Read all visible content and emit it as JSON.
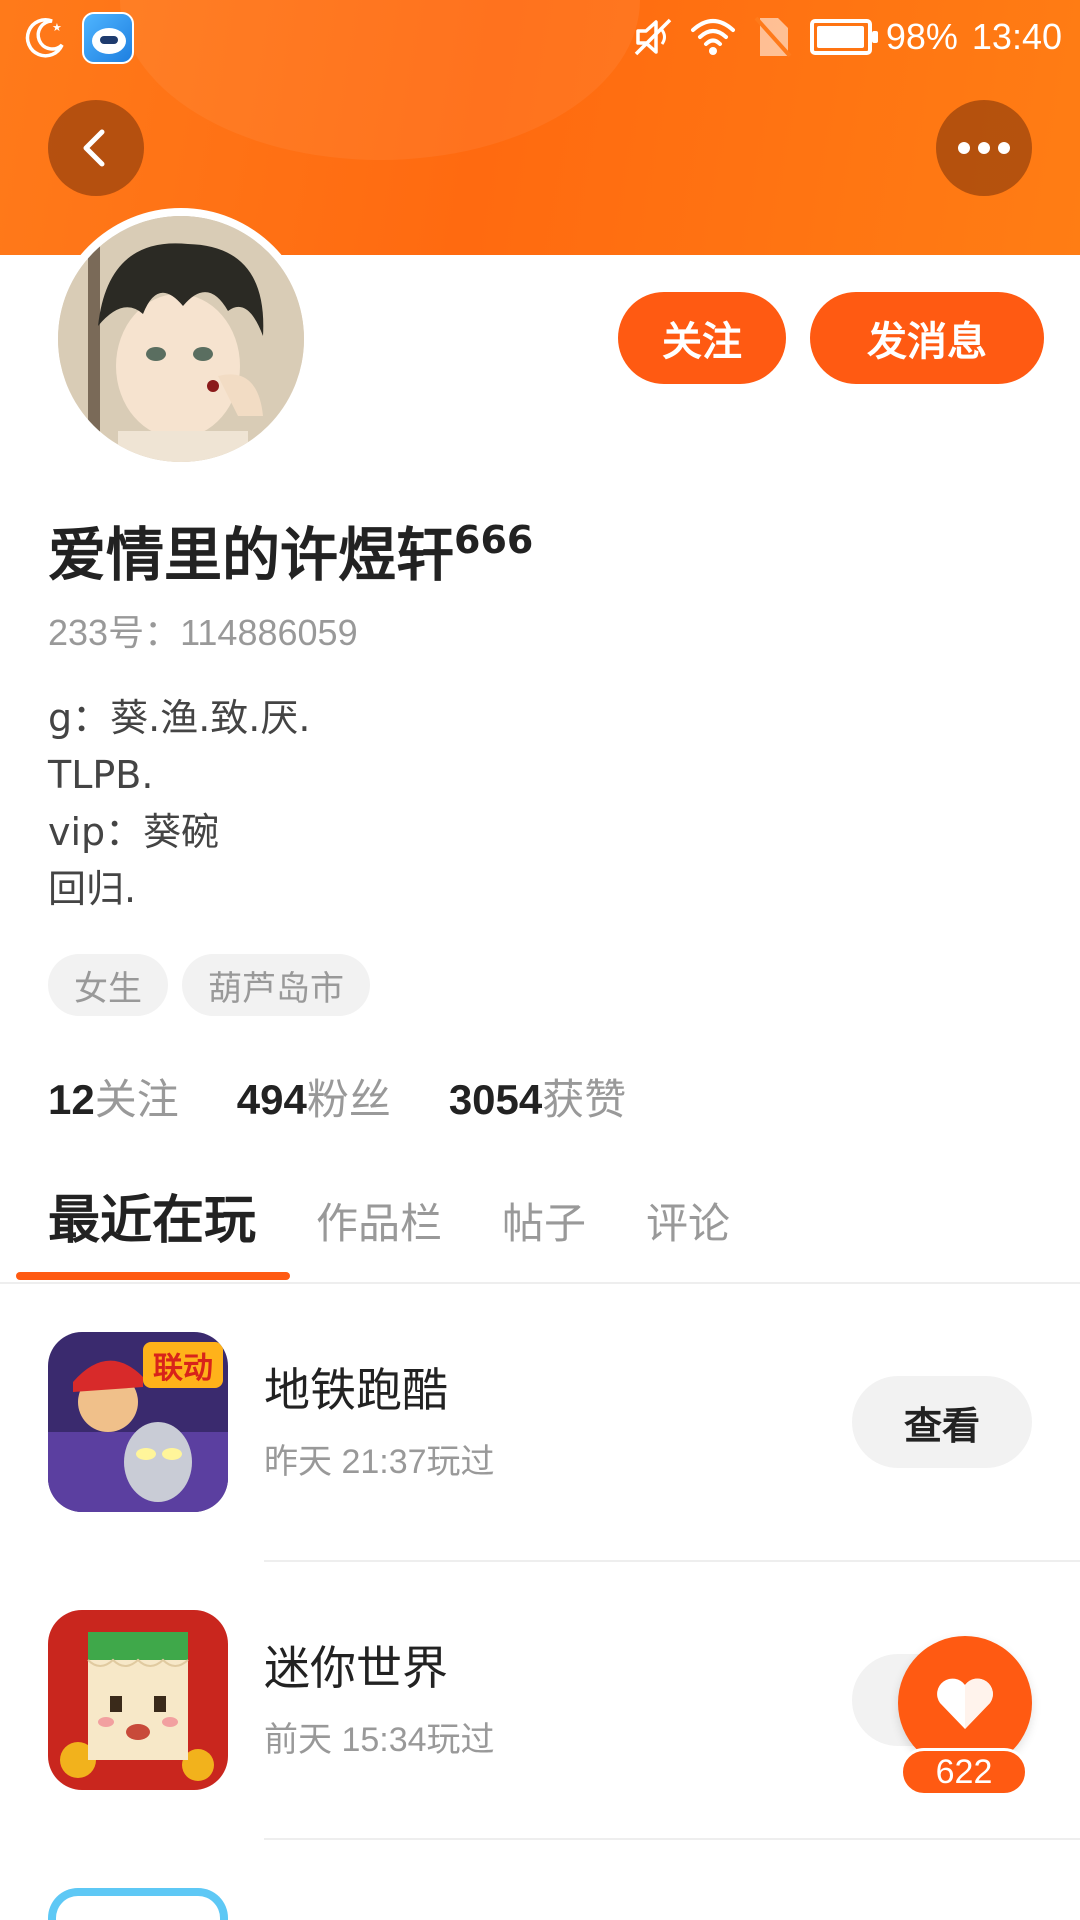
{
  "status_bar": {
    "battery_text": "98%",
    "time": "13:40",
    "battery_level": 0.98
  },
  "header": {
    "back_icon": "chevron-left-icon",
    "more_icon": "more-horizontal-icon"
  },
  "profile": {
    "follow_label": "关注",
    "message_label": "发消息",
    "name": "爱情里的许煜轩",
    "name_suffix": "666",
    "id_text": "233号：114886059",
    "bio": [
      "g：葵.渔.致.厌.",
      "TLPB.",
      "vip：葵碗",
      "回归."
    ],
    "tags": [
      "女生",
      "葫芦岛市"
    ],
    "stats": [
      {
        "num": "12",
        "label": "关注"
      },
      {
        "num": "494",
        "label": "粉丝"
      },
      {
        "num": "3054",
        "label": "获赞"
      }
    ]
  },
  "tabs": [
    "最近在玩",
    "作品栏",
    "帖子",
    "评论"
  ],
  "games": [
    {
      "name": "地铁跑酷",
      "time": "昨天 21:37玩过",
      "button": "查看",
      "badge": "联动"
    },
    {
      "name": "迷你世界",
      "time": "前天 15:34玩过",
      "button": "查看"
    }
  ],
  "fab": {
    "count": "622",
    "icon": "heart-icon"
  },
  "colors": {
    "accent": "#ff5a12",
    "header": "#ff7a1a"
  }
}
